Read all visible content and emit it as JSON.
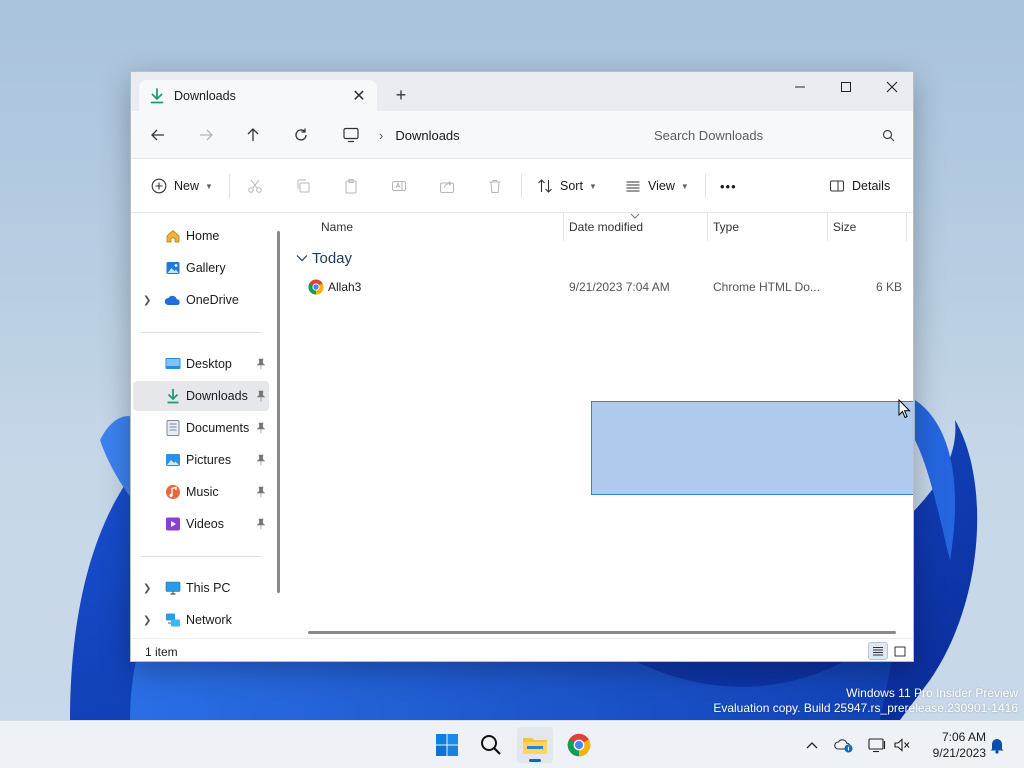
{
  "window": {
    "tab_title": "Downloads",
    "address": {
      "crumb": "Downloads"
    },
    "search": {
      "placeholder": "Search Downloads"
    },
    "commands": {
      "new_label": "New",
      "sort_label": "Sort",
      "view_label": "View",
      "more_label": "•••",
      "details_label": "Details"
    },
    "nav": {
      "items": [
        {
          "label": "Home",
          "icon": "home-icon",
          "expander": false,
          "pinned": false
        },
        {
          "label": "Gallery",
          "icon": "gallery-icon",
          "expander": false,
          "pinned": false
        },
        {
          "label": "OneDrive",
          "icon": "onedrive-icon",
          "expander": true,
          "pinned": false
        },
        {
          "label": "Desktop",
          "icon": "desktop-folder-icon",
          "expander": false,
          "pinned": true
        },
        {
          "label": "Downloads",
          "icon": "downloads-folder-icon",
          "expander": false,
          "pinned": true,
          "selected": true
        },
        {
          "label": "Documents",
          "icon": "documents-folder-icon",
          "expander": false,
          "pinned": true
        },
        {
          "label": "Pictures",
          "icon": "pictures-folder-icon",
          "expander": false,
          "pinned": true
        },
        {
          "label": "Music",
          "icon": "music-folder-icon",
          "expander": false,
          "pinned": true
        },
        {
          "label": "Videos",
          "icon": "videos-folder-icon",
          "expander": false,
          "pinned": true
        },
        {
          "label": "This PC",
          "icon": "this-pc-icon",
          "expander": true,
          "pinned": false
        },
        {
          "label": "Network",
          "icon": "network-icon",
          "expander": true,
          "pinned": false
        }
      ]
    },
    "columns": {
      "name": "Name",
      "date_modified": "Date modified",
      "type": "Type",
      "size": "Size"
    },
    "group": {
      "label": "Today"
    },
    "files": [
      {
        "name": "Allah3",
        "date_modified": "9/21/2023 7:04 AM",
        "type": "Chrome HTML Do...",
        "size": "6 KB",
        "icon": "chrome-icon"
      }
    ],
    "status": {
      "count": "1 item"
    }
  },
  "watermark": {
    "line1": "Windows 11 Pro Insider Preview",
    "line2": "Evaluation copy. Build 25947.rs_prerelease.230901-1416"
  },
  "taskbar": {
    "apps": [
      "start-icon",
      "search-icon",
      "file-explorer-icon",
      "chrome-icon"
    ],
    "clock": {
      "time": "7:06 AM",
      "date": "9/21/2023"
    }
  },
  "colors": {
    "accent": "#0067c0",
    "selection_fill": "#aecbee",
    "selection_border": "#3c80d4",
    "nav_selected": "#e6e7ea"
  }
}
